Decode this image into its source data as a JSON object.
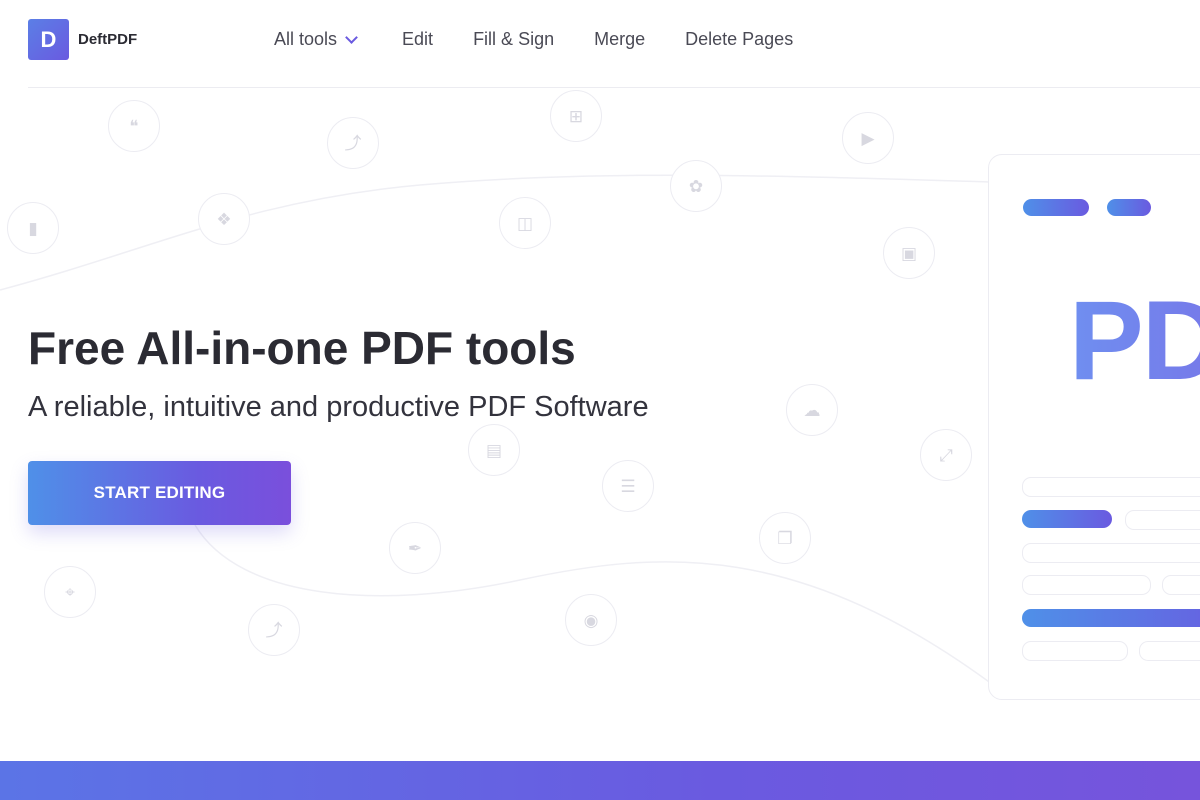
{
  "brand": {
    "logo_letter": "D",
    "name": "DeftPDF"
  },
  "nav": {
    "all_tools": "All tools",
    "edit": "Edit",
    "fill_sign": "Fill & Sign",
    "merge": "Merge",
    "delete_pages": "Delete Pages"
  },
  "hero": {
    "title": "Free All-in-one PDF tools",
    "subtitle": "A reliable, intuitive and productive PDF Software",
    "cta_label": "START EDITING"
  },
  "mockup": {
    "big_text": "PDF"
  },
  "colors": {
    "accent_start": "#4f90e8",
    "accent_end": "#6a5ae0",
    "text_dark": "#2b2b33",
    "nav_text": "#4a4a55"
  }
}
